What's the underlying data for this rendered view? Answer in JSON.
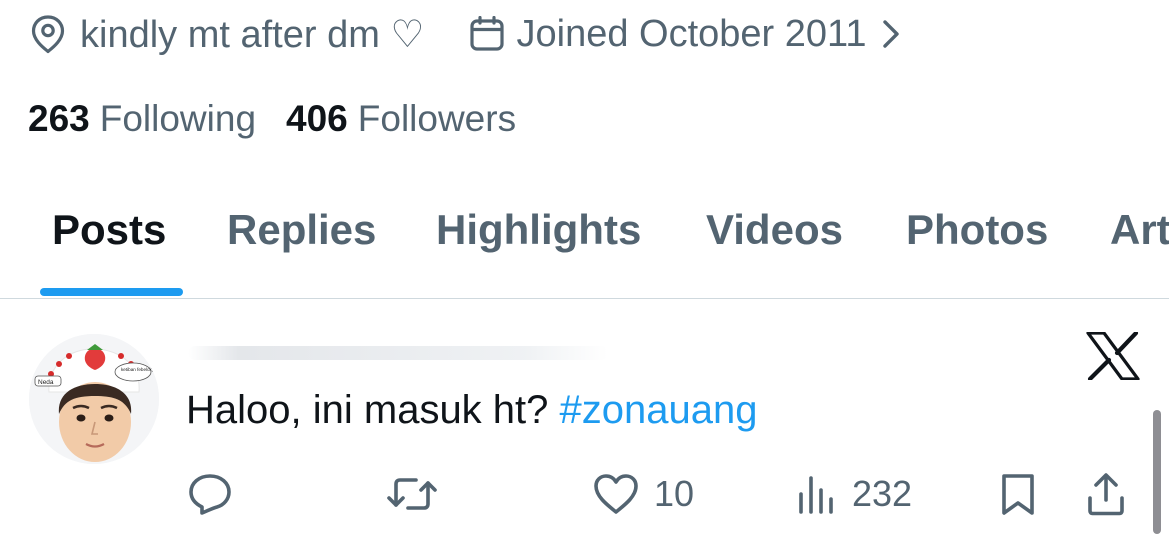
{
  "profile": {
    "location": "kindly mt after dm ♡",
    "joined": "Joined October 2011",
    "following_count": "263",
    "following_label": "Following",
    "followers_count": "406",
    "followers_label": "Followers"
  },
  "tabs": [
    {
      "label": "Posts",
      "active": true
    },
    {
      "label": "Replies",
      "active": false
    },
    {
      "label": "Highlights",
      "active": false
    },
    {
      "label": "Videos",
      "active": false
    },
    {
      "label": "Photos",
      "active": false
    },
    {
      "label": "Articles",
      "active": false
    }
  ],
  "post": {
    "text": "Haloo, ini masuk ht? ",
    "hashtag": "#zonauang",
    "avatar_caption_left": "Neda",
    "avatar_caption_right": "ketiban febelcky",
    "likes": "10",
    "views": "232"
  },
  "icons": {
    "location": "location-pin-icon",
    "calendar": "calendar-icon",
    "chevron": "chevron-right-icon",
    "x": "x-logo-icon",
    "reply": "reply-icon",
    "repost": "repost-icon",
    "like": "heart-icon",
    "views": "views-icon",
    "bookmark": "bookmark-icon",
    "share": "share-icon"
  },
  "colors": {
    "accent": "#1d9bf0",
    "text_primary": "#0f1419",
    "text_secondary": "#536471",
    "divider": "#cfd9de"
  }
}
